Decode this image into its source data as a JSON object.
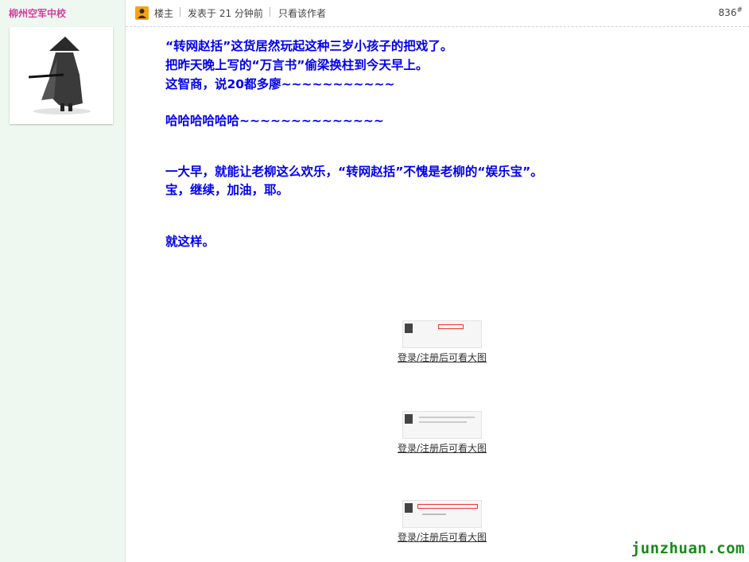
{
  "author": {
    "username": "柳州空军中校"
  },
  "post": {
    "role_label": "楼主",
    "posted_time": "发表于 21 分钟前",
    "author_only_link": "只看该作者",
    "floor_number": "836",
    "floor_symbol": "#",
    "lines": [
      "“转网赵括”这货居然玩起这种三岁小孩子的把戏了。",
      "把昨天晚上写的“万言书”偷梁换柱到今天早上。",
      "这智商，说20都多廖~~~~~~~~~~~",
      "哈哈哈哈哈哈~~~~~~~~~~~~~~",
      "一大早，就能让老柳这么欢乐，“转网赵括”不愧是老柳的“娱乐宝”。",
      "宝，继续，加油，耶。",
      "就这样。"
    ],
    "attachments": [
      {
        "link_text": "登录/注册后可看大图"
      },
      {
        "link_text": "登录/注册后可看大图"
      },
      {
        "link_text": "登录/注册后可看大图"
      }
    ]
  },
  "watermark": "junzhuan.com",
  "colors": {
    "username": "#d63d9d",
    "content_text": "#0000ee",
    "sidebar_bg": "#eef8f1",
    "badge": "#f3a418",
    "watermark": "#1a8a1a"
  }
}
